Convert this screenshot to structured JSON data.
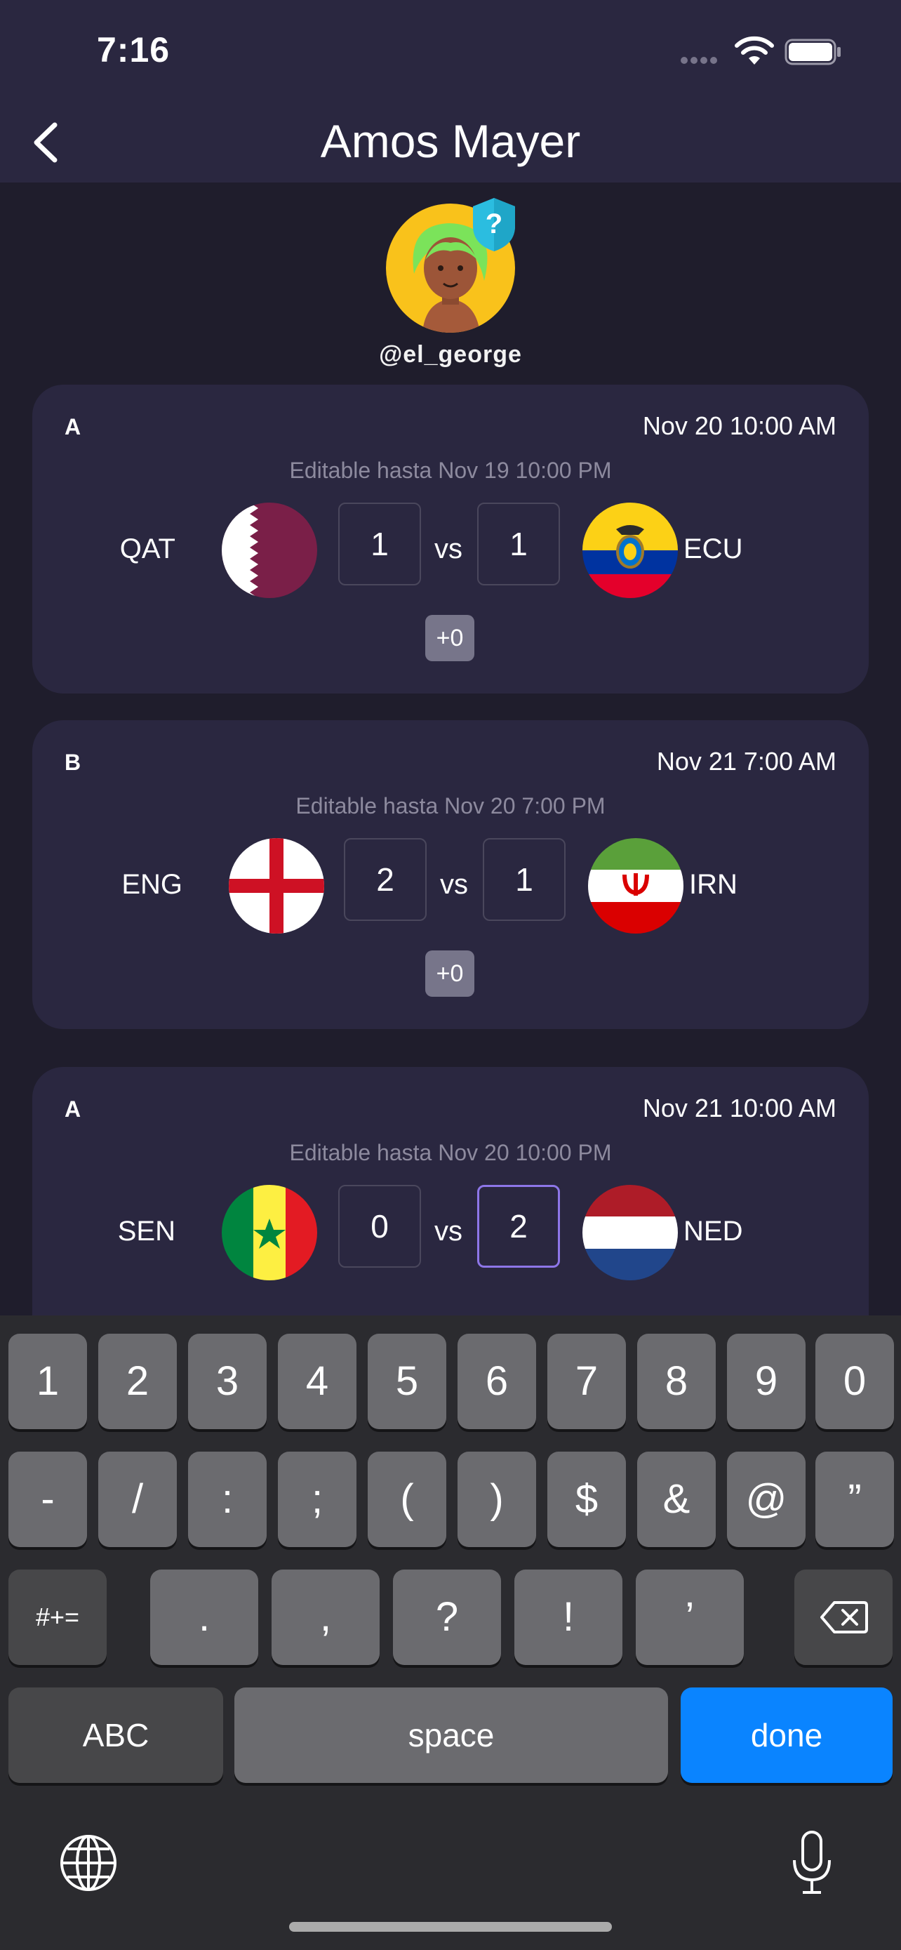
{
  "status": {
    "time": "7:16"
  },
  "header": {
    "title": "Amos Mayer"
  },
  "profile": {
    "username": "@el_george"
  },
  "matches": [
    {
      "group": "A",
      "date": "Nov 20 10:00 AM",
      "editable": "Editable hasta Nov 19 10:00 PM",
      "home": "QAT",
      "away": "ECU",
      "home_score": "1",
      "away_score": "1",
      "vs": "vs",
      "points": "+0"
    },
    {
      "group": "B",
      "date": "Nov 21 7:00 AM",
      "editable": "Editable hasta Nov 20 7:00 PM",
      "home": "ENG",
      "away": "IRN",
      "home_score": "2",
      "away_score": "1",
      "vs": "vs",
      "points": "+0"
    },
    {
      "group": "A",
      "date": "Nov 21 10:00 AM",
      "editable": "Editable hasta Nov 20 10:00 PM",
      "home": "SEN",
      "away": "NED",
      "home_score": "0",
      "away_score": "2",
      "vs": "vs"
    }
  ],
  "keyboard": {
    "row1": [
      "1",
      "2",
      "3",
      "4",
      "5",
      "6",
      "7",
      "8",
      "9",
      "0"
    ],
    "row2": [
      "-",
      "/",
      ":",
      ";",
      "(",
      ")",
      "$",
      "&",
      "@",
      "”"
    ],
    "row3": [
      ".",
      ",",
      "?",
      "!",
      "’"
    ],
    "mode_key": "#+=",
    "abc": "ABC",
    "space": "space",
    "done": "done"
  },
  "colors": {
    "background": "#1f1d2c",
    "card": "#2a2740",
    "accent": "#8d76e8",
    "done_key": "#0a84ff"
  }
}
